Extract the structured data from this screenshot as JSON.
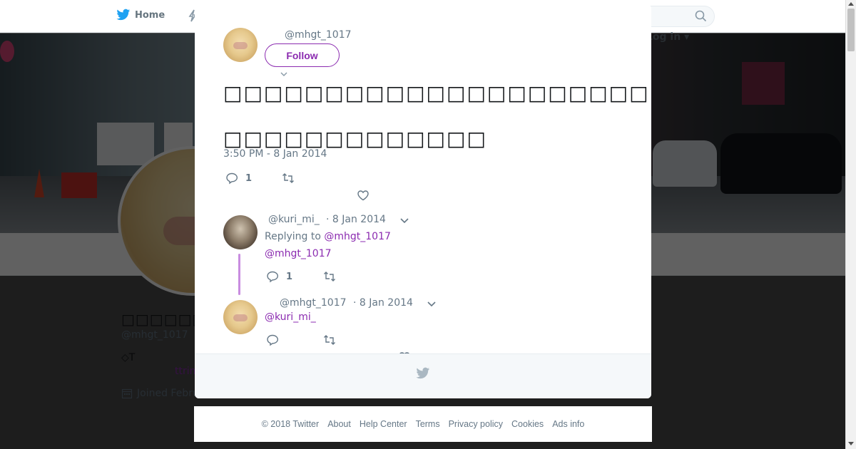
{
  "nav": {
    "home_label": "Home",
    "login_label": "Log in ▾"
  },
  "search": {
    "placeholder": ""
  },
  "profile": {
    "name": "□□□□□□□□□□□□",
    "handle": "@mhgt_1017",
    "bio": "◇T",
    "link_fragment": "ttrin",
    "joined": "Joined February"
  },
  "tweet": {
    "handle": "@mhgt_1017",
    "follow_label": "Follow",
    "text_line1": "□□□□□□□□□□□□□□□□□□□□□",
    "text_line2": "□□□□□□□□□□□□□",
    "timestamp": "3:50 PM - 8 Jan 2014",
    "reply_count": "1",
    "retweet_count": "",
    "like_count": ""
  },
  "replies": [
    {
      "handle": "@kuri_mi_",
      "date": "· 8 Jan 2014",
      "replying_prefix": "Replying to ",
      "replying_to": "@mhgt_1017",
      "text": "@mhgt_1017",
      "reply_count": "1"
    },
    {
      "handle": "@mhgt_1017",
      "date": "· 8 Jan 2014",
      "text": "@kuri_mi_",
      "reply_count": ""
    }
  ],
  "footer": {
    "copyright": "© 2018 Twitter",
    "links": [
      "About",
      "Help Center",
      "Terms",
      "Privacy policy",
      "Cookies",
      "Ads info"
    ]
  },
  "colors": {
    "accent": "#8b2bb0",
    "muted": "#657786",
    "thread": "#c98de0"
  }
}
